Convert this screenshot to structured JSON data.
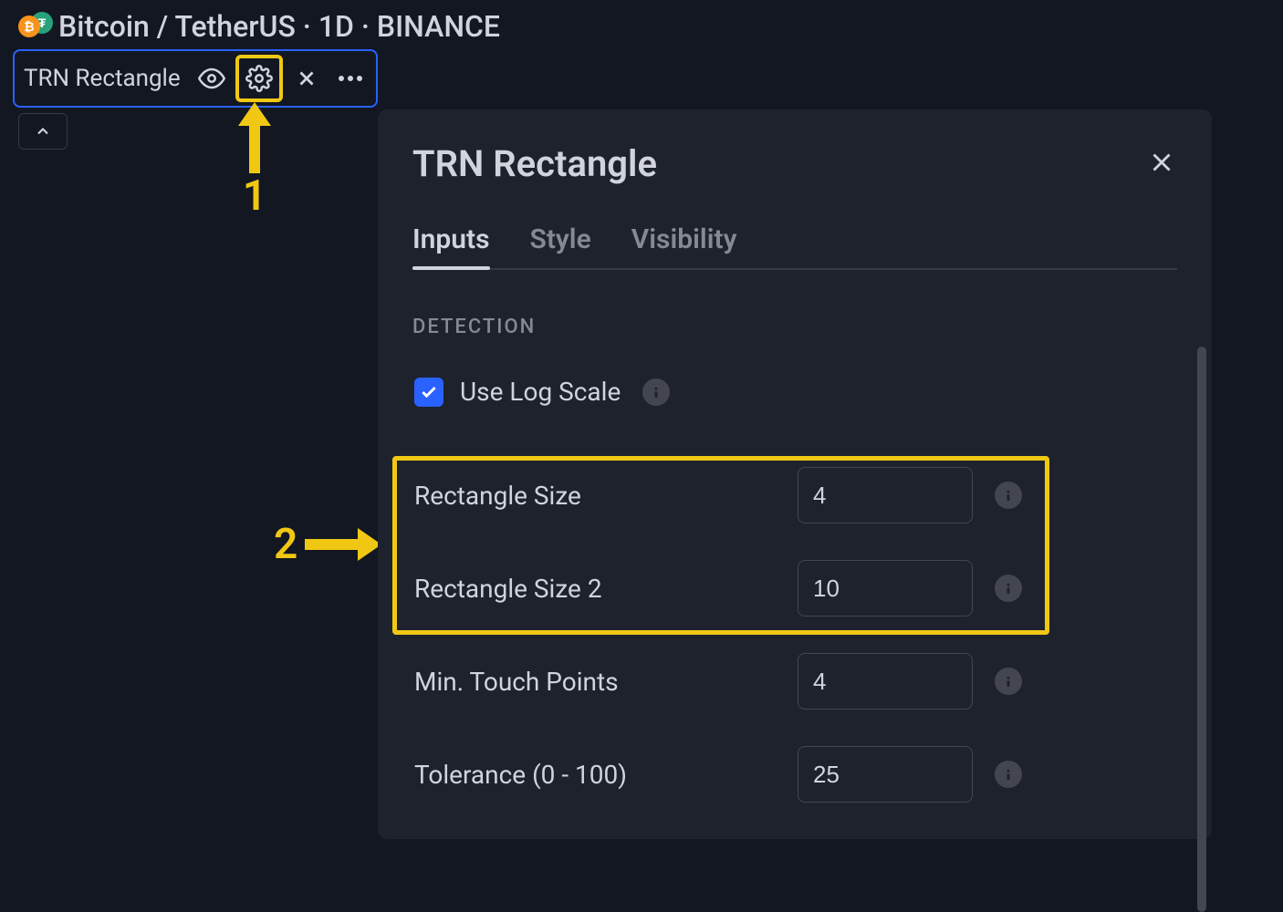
{
  "header": {
    "symbol_title": "Bitcoin / TetherUS · 1D · BINANCE"
  },
  "indicator": {
    "name": "TRN Rectangle"
  },
  "annotations": {
    "label_1": "1",
    "label_2": "2"
  },
  "dialog": {
    "title": "TRN Rectangle",
    "tabs": {
      "inputs": "Inputs",
      "style": "Style",
      "visibility": "Visibility"
    },
    "section_detection": "DETECTION",
    "use_log_scale": {
      "label": "Use Log Scale",
      "checked": true
    },
    "inputs": {
      "rectangle_size": {
        "label": "Rectangle Size",
        "value": "4"
      },
      "rectangle_size_2": {
        "label": "Rectangle Size 2",
        "value": "10"
      },
      "min_touch_points": {
        "label": "Min. Touch Points",
        "value": "4"
      },
      "tolerance": {
        "label": "Tolerance (0 - 100)",
        "value": "25"
      }
    }
  }
}
